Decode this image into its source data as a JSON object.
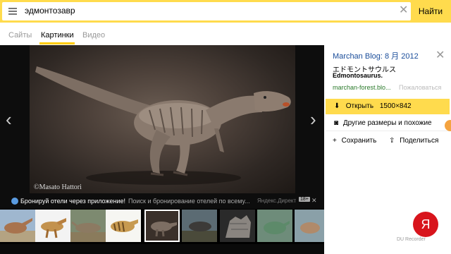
{
  "search": {
    "query": "эдмонтозавр",
    "find_label": "Найти"
  },
  "tabs": [
    {
      "label": "Сайты"
    },
    {
      "label": "Картинки"
    },
    {
      "label": "Видео"
    }
  ],
  "viewer": {
    "copyright": "©Masato Hattori",
    "prev": "‹",
    "next": "›"
  },
  "ad": {
    "bold": "Бронируй отели через приложение!",
    "text": "Поиск и бронирование отелей по всему...",
    "direct": "Яндекс.Директ",
    "age": "18+",
    "close": "✕"
  },
  "panel": {
    "source_title": "Marchan Blog: 8 月 2012",
    "jp_title": "エドモントサウルス",
    "latin_title": "Edmontosaurus.",
    "domain": "marchan-forest.blo...",
    "visit": "Пожаловаться",
    "open_label": "Открыть",
    "open_size": "1500×842",
    "other_sizes": "Другие размеры и похожие",
    "save": "Сохранить",
    "share": "Поделиться"
  },
  "logo": {
    "letter": "Я"
  },
  "watermark": "DU Recorder",
  "colors": {
    "brand_yellow": "#ffdb4d",
    "link_blue": "#1a4d9a",
    "domain_green": "#2a7a2a",
    "yandex_red": "#d8141c"
  },
  "icons": [
    "menu-icon",
    "clear-icon",
    "chevron-left-icon",
    "chevron-right-icon",
    "download-icon",
    "camera-icon",
    "share-icon",
    "close-icon"
  ]
}
